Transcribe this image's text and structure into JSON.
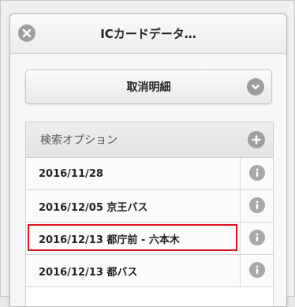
{
  "header": {
    "title": "ICカードデータ…",
    "close_icon": "close-icon"
  },
  "cancel": {
    "label": "取消明細",
    "icon": "chevron-down-icon"
  },
  "search": {
    "label": "検索オプション",
    "icon": "plus-icon"
  },
  "rows": [
    {
      "label": "2016/11/28",
      "icon": "info-icon",
      "highlighted": false
    },
    {
      "label": "2016/12/05 京王バス",
      "icon": "info-icon",
      "highlighted": false
    },
    {
      "label": "2016/12/13 都庁前 - 六本木",
      "icon": "info-icon",
      "highlighted": true
    },
    {
      "label": "2016/12/13 都バス",
      "icon": "info-icon",
      "highlighted": false
    }
  ],
  "colors": {
    "highlight": "#e0141e",
    "icon_gray": "#9e9e9e"
  }
}
